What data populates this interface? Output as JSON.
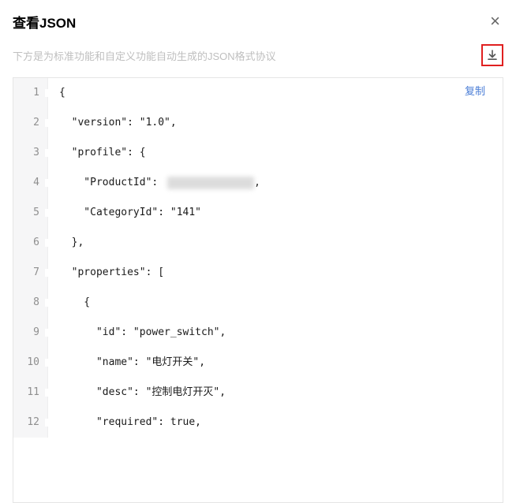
{
  "header": {
    "title": "查看JSON",
    "close_label": "×"
  },
  "subtitle": "下方是为标准功能和自定义功能自动生成的JSON格式协议",
  "actions": {
    "download_icon": "download-icon",
    "copy_label": "复制"
  },
  "code": {
    "lines": [
      {
        "num": "1",
        "indent": 0,
        "text": "{"
      },
      {
        "num": "2",
        "indent": 1,
        "text": "\"version\": \"1.0\","
      },
      {
        "num": "3",
        "indent": 1,
        "text": "\"profile\": {"
      },
      {
        "num": "4",
        "indent": 2,
        "text": "\"ProductId\": ",
        "redacted": true
      },
      {
        "num": "5",
        "indent": 2,
        "text": "\"CategoryId\": \"141\""
      },
      {
        "num": "6",
        "indent": 1,
        "text": "},"
      },
      {
        "num": "7",
        "indent": 1,
        "text": "\"properties\": ["
      },
      {
        "num": "8",
        "indent": 2,
        "text": "{"
      },
      {
        "num": "9",
        "indent": 3,
        "text": "\"id\": \"power_switch\","
      },
      {
        "num": "10",
        "indent": 3,
        "text": "\"name\": \"电灯开关\","
      },
      {
        "num": "11",
        "indent": 3,
        "text": "\"desc\": \"控制电灯开灭\","
      },
      {
        "num": "12",
        "indent": 3,
        "text": "\"required\": true,"
      }
    ]
  }
}
